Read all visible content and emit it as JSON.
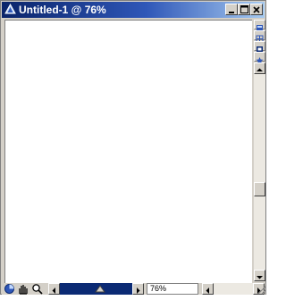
{
  "window": {
    "title": "Untitled-1 @ 76%",
    "controls": {
      "minimize_icon": "minimize-icon",
      "maximize_icon": "maximize-icon",
      "close_icon": "close-icon"
    }
  },
  "status": {
    "zoom": "76%"
  },
  "colors": {
    "titlebar_start": "#0a246a",
    "titlebar_end": "#a6caf0",
    "chrome": "#d4d0c8",
    "canvas": "#ffffff"
  }
}
